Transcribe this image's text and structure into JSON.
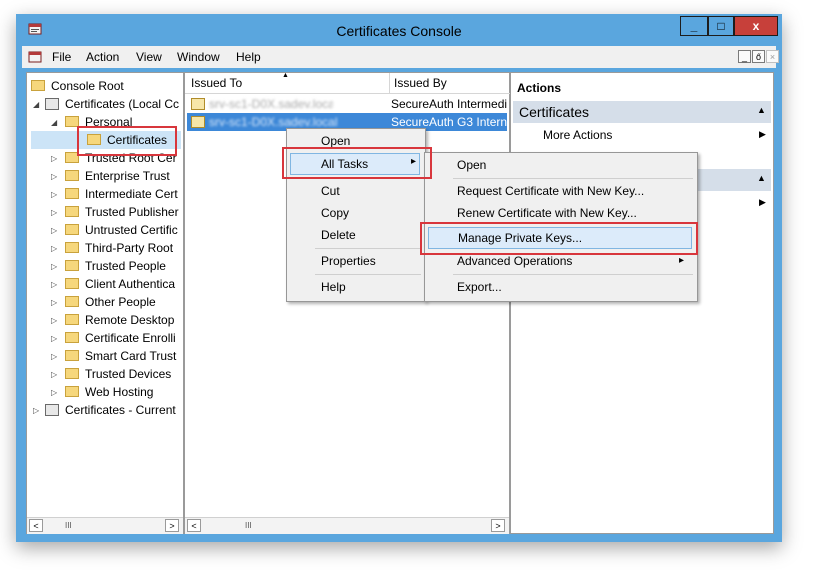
{
  "window": {
    "title": "Certificates Console",
    "min_label": "_",
    "max_label": "□",
    "close_label": "x"
  },
  "menubar": {
    "items": [
      "File",
      "Action",
      "View",
      "Window",
      "Help"
    ],
    "mdi_min": "_",
    "mdi_restore": "ő",
    "mdi_close": "×"
  },
  "tree": {
    "items": [
      {
        "label": "Console Root"
      },
      {
        "label": "Certificates (Local Cc"
      },
      {
        "label": "Personal"
      },
      {
        "label": "Certificates"
      },
      {
        "label": "Trusted Root Cer"
      },
      {
        "label": "Enterprise Trust"
      },
      {
        "label": "Intermediate Cert"
      },
      {
        "label": "Trusted Publisher"
      },
      {
        "label": "Untrusted Certific"
      },
      {
        "label": "Third-Party Root"
      },
      {
        "label": "Trusted People"
      },
      {
        "label": "Client Authentica"
      },
      {
        "label": "Other People"
      },
      {
        "label": "Remote Desktop"
      },
      {
        "label": "Certificate Enrolli"
      },
      {
        "label": "Smart Card Trust"
      },
      {
        "label": "Trusted Devices"
      },
      {
        "label": "Web Hosting"
      },
      {
        "label": "Certificates - Current"
      }
    ],
    "scroll_left": "<",
    "scroll_right": ">",
    "scroll_thumb": "III"
  },
  "list": {
    "columns": [
      "Issued To",
      "Issued By"
    ],
    "sort_arrow": "▲",
    "rows": [
      {
        "issued_to": "srv-sc1-D0X.sadev.local",
        "issued_by": "SecureAuth Intermedi"
      },
      {
        "issued_to": "srv-sc1-D0X.sadev.local",
        "issued_by": "SecureAuth G3 Intern"
      }
    ],
    "scroll_left": "<",
    "scroll_right": ">",
    "scroll_thumb": "III"
  },
  "actions": {
    "header": "Actions",
    "section1": "Certificates",
    "more_actions": "More Actions",
    "collapse_glyph": "▲",
    "more_glyph": "▶"
  },
  "context_menu": {
    "open": "Open",
    "all_tasks": "All Tasks",
    "cut": "Cut",
    "copy": "Copy",
    "delete": "Delete",
    "properties": "Properties",
    "help": "Help",
    "submenu_arrow": "▸"
  },
  "submenu": {
    "open": "Open",
    "request_new_key": "Request Certificate with New Key...",
    "renew_new_key": "Renew Certificate with New Key...",
    "manage_private_keys": "Manage Private Keys...",
    "advanced_operations": "Advanced Operations",
    "export": "Export...",
    "submenu_arrow": "▸"
  },
  "colors": {
    "frame": "#5aa6de",
    "close_button": "#c7403a",
    "selection": "#3d88d8",
    "highlight_box": "#d8363c"
  }
}
